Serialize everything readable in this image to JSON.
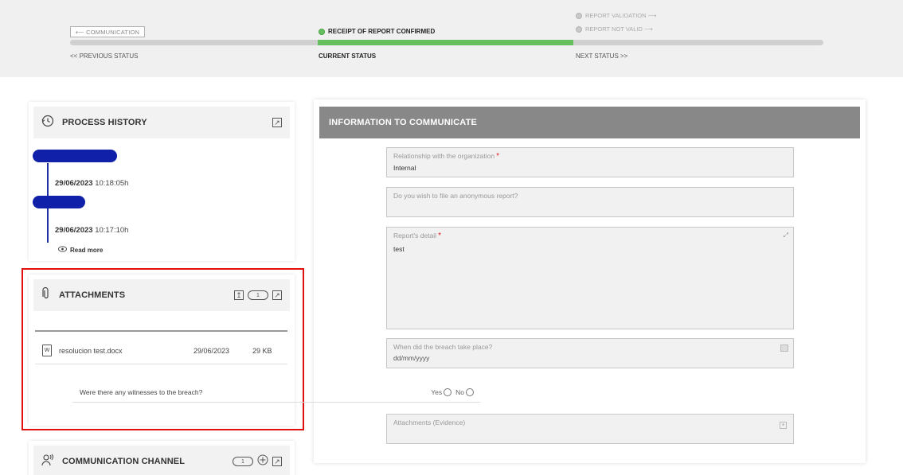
{
  "status": {
    "previous_button": "⟵ COMMUNICATION",
    "previous_label": "<< PREVIOUS STATUS",
    "current": "RECEIPT OF REPORT CONFIRMED",
    "current_label": "CURRENT STATUS",
    "next_options": [
      "REPORT VALIDATION ⟶",
      "REPORT NOT VALID ⟶"
    ],
    "next_label": "NEXT STATUS >>"
  },
  "process_history": {
    "title": "PROCESS HISTORY",
    "entries": [
      {
        "date": "29/06/2023",
        "time": "10:18:05h"
      },
      {
        "date": "29/06/2023",
        "time": "10:17:10h"
      }
    ],
    "read_more": "Read more"
  },
  "attachments": {
    "title": "ATTACHMENTS",
    "count": "1",
    "files": [
      {
        "name": "resolucion test.docx",
        "date": "29/06/2023",
        "size": "29 KB",
        "type_glyph": "W"
      }
    ]
  },
  "communication_channel": {
    "title": "COMMUNICATION CHANNEL",
    "count": "1"
  },
  "info_panel": {
    "title": "INFORMATION TO COMMUNICATE",
    "relationship_label": "Relationship with the organization",
    "relationship_value": "Internal",
    "anonymous_label": "Do you wish to file an anonymous report?",
    "detail_label": "Report's detail",
    "detail_value": "test",
    "breach_date_label": "When did the breach take place?",
    "breach_date_placeholder": "dd/mm/yyyy",
    "witnesses_label": "Were there any witnesses to the breach?",
    "yes_label": "Yes",
    "no_label": "No",
    "evidence_label": "Attachments (Evidence)"
  },
  "colors": {
    "progress_current": "#66c060",
    "timeline_pill": "#1020a8",
    "highlight_frame": "#e01010",
    "panel_header": "#888888"
  }
}
